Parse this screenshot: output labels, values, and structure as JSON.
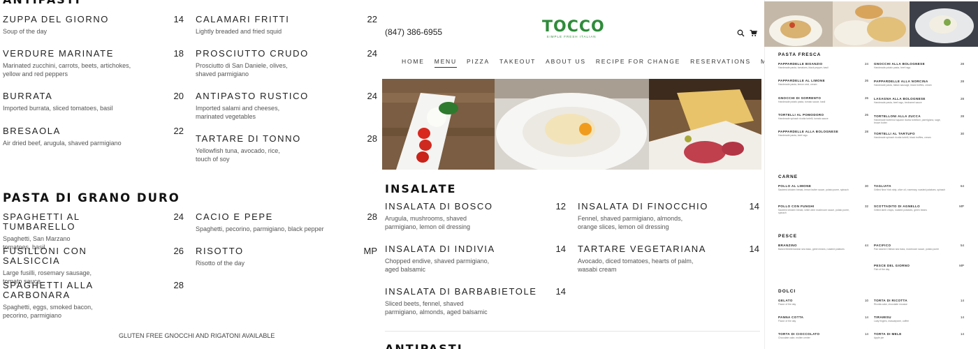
{
  "left": {
    "top_section_title": "ANTIPASTI",
    "antipasti_col1": [
      {
        "name": "ZUPPA DEL GIORNO",
        "desc": "Soup of the day",
        "price": "14"
      },
      {
        "name": "VERDURE MARINATE",
        "desc": "Marinated zucchini, carrots, beets, artichokes, yellow and red peppers",
        "price": "18"
      },
      {
        "name": "BURRATA",
        "desc": "Imported burrata, sliced tomatoes, basil",
        "price": "20"
      },
      {
        "name": "BRESAOLA",
        "desc": "Air dried beef, arugula, shaved parmigiano",
        "price": "22"
      }
    ],
    "antipasti_col2": [
      {
        "name": "CALAMARI FRITTI",
        "desc": "Lightly breaded and fried squid",
        "price": "22"
      },
      {
        "name": "PROSCIUTTO CRUDO",
        "desc": "Prosciutto di San Daniele, olives, shaved parmigiano",
        "price": "24"
      },
      {
        "name": "ANTIPASTO RUSTICO",
        "desc": "Imported salami and cheeses, marinated vegetables",
        "price": "24"
      },
      {
        "name": "TARTARE DI TONNO",
        "desc": "Yellowfish tuna, avocado, rice, touch of soy",
        "price": "28"
      }
    ],
    "pasta_title": "PASTA DI GRANO DURO",
    "pasta_col1": [
      {
        "name": "SPAGHETTI AL TUMBARELLO",
        "desc": "Spaghetti, San Marzano tomatoes, basil",
        "price": "24"
      },
      {
        "name": "FUSILLONI CON SALSICCIA",
        "desc": "Large fusilli, rosemary sausage, tomato sauce",
        "price": "26"
      },
      {
        "name": "SPAGHETTI ALLA CARBONARA",
        "desc": "Spaghetti, eggs, smoked bacon, pecorino, parmigiano",
        "price": "28"
      }
    ],
    "pasta_col2": [
      {
        "name": "CACIO E PEPE",
        "desc": "Spaghetti, pecorino, parmigiano, black pepper",
        "price": "28"
      },
      {
        "name": "RISOTTO",
        "desc": "Risotto of the day",
        "price": "MP"
      }
    ],
    "gluten_note": "GLUTEN FREE GNOCCHI AND RIGATONI AVAILABLE"
  },
  "center": {
    "phone": "(847) 386-6955",
    "logo": "TOCCO",
    "tagline": "SIMPLE FRESH ITALIAN",
    "brand_color": "#2e8b3a",
    "icons": [
      "search-icon",
      "cart-icon"
    ],
    "nav": [
      "HOME",
      "MENU",
      "PIZZA",
      "TAKEOUT",
      "ABOUT US",
      "RECIPE FOR CHANGE",
      "RESERVATIONS",
      "MORE ▾"
    ],
    "active_nav": "MENU",
    "insalate_title": "INSALATE",
    "insalate_col1": [
      {
        "name": "INSALATA DI BOSCO",
        "desc": "Arugula, mushrooms, shaved parmigiano, lemon oil dressing",
        "price": "12"
      },
      {
        "name": "INSALATA DI INDIVIA",
        "desc": "Chopped endive, shaved parmigiano, aged balsamic",
        "price": "14"
      },
      {
        "name": "INSALATA DI BARBABIETOLE",
        "desc": "Sliced beets, fennel, shaved parmigiano, almonds, aged balsamic",
        "price": "14"
      }
    ],
    "insalate_col2": [
      {
        "name": "INSALATA DI FINOCCHIO",
        "desc": "Fennel, shaved parmigiano, almonds, orange slices, lemon oil dressing",
        "price": "14"
      },
      {
        "name": "TARTARE VEGETARIANA",
        "desc": "Avocado, diced tomatoes, hearts of palm, wasabi cream",
        "price": "14"
      }
    ],
    "bottom_title": "ANTIPASTI"
  },
  "right": {
    "pasta_fresca": "PASTA FRESCA",
    "pf_col1": [
      {
        "name": "PAPPARDELLE BISANZIO",
        "desc": "Handmade pasta, tomatoes, black pepper, basil",
        "price": "24"
      },
      {
        "name": "PAPPARDELLE AL LIMONE",
        "desc": "Handmade pasta, lemon zest, cream",
        "price": "26"
      },
      {
        "name": "GNOCCHI DI SORRENTO",
        "desc": "Handmade potato pasta, tomato sauce, basil",
        "price": "26"
      },
      {
        "name": "TORTELLI AL POMODORO",
        "desc": "Handmade spinach ricotta tortelli, tomato sauce",
        "price": "26"
      },
      {
        "name": "PAPPARDELLE ALLA BOLOGNESE",
        "desc": "Handmade pasta, beef ragu",
        "price": "28"
      }
    ],
    "pf_col2": [
      {
        "name": "GNOCCHI ALLA BOLOGNESE",
        "desc": "Handmade potato pasta, beef ragu",
        "price": "28"
      },
      {
        "name": "PAPPARDELLE ALLA NORCINA",
        "desc": "Handmade pasta, Italian sausage, black truffles, cream",
        "price": "28"
      },
      {
        "name": "LASAGNA ALLA BOLOGNESE",
        "desc": "Handmade pasta, beef ragu, bechamel sauce",
        "price": "28"
      },
      {
        "name": "TORTELLONI ALLA ZUCCA",
        "desc": "Handmade butternut squash ricotta tortelloni, parmigiano, sage, brown butter",
        "price": "28"
      },
      {
        "name": "TORTELLI AL TARTUFO",
        "desc": "Handmade spinach ricotta tortelli, black truffles, cream",
        "price": "30"
      }
    ],
    "carne": "CARNE",
    "carne_col1": [
      {
        "name": "POLLO AL LIMONE",
        "desc": "Sauteed chicken breast, lemon butter sauce, potato puree, spinach",
        "price": "30"
      },
      {
        "name": "POLLO CON FUNGHI",
        "desc": "Sauteed chicken breast, white wine mushroom sauce, potato puree, spinach",
        "price": "32"
      }
    ],
    "carne_col2": [
      {
        "name": "TAGLIATA",
        "desc": "Grilled New York strip, olive oil, rosemary, roasted potatoes, spinach",
        "price": "64"
      },
      {
        "name": "SCOTTADITO DI AGNELLO",
        "desc": "Grilled lamb chops, roasted potatoes, green beans",
        "price": "MP"
      }
    ],
    "pesce": "PESCE",
    "pesce_col1": [
      {
        "name": "BRANZINO",
        "desc": "Baked Mediterranean sea bass, green beans, roasted potatoes",
        "price": "44"
      }
    ],
    "pesce_col2": [
      {
        "name": "PACIFICO",
        "desc": "Pan seared Chilean sea bass, mushroom sauce, potato puree",
        "price": "54"
      },
      {
        "name": "PESCE DEL GIORNO",
        "desc": "Fish of the day",
        "price": "MP"
      }
    ],
    "dolci": "DOLCI",
    "dolci_col1": [
      {
        "name": "GELATO",
        "desc": "Flavor of the day",
        "price": "10"
      },
      {
        "name": "PANNA COTTA",
        "desc": "Flavor of the day",
        "price": "14"
      },
      {
        "name": "TORTA DI CIOCCOLATO",
        "desc": "Chocolate cake, molten center",
        "price": "14"
      }
    ],
    "dolci_col2": [
      {
        "name": "TORTA DI RICOTTA",
        "desc": "Ricotta cake, chocolate mousse",
        "price": "14"
      },
      {
        "name": "TIRAMISU",
        "desc": "Lady fingers, mascarpone, coffee",
        "price": "14"
      },
      {
        "name": "TORTA DI MELE",
        "desc": "Apple pie",
        "price": "14"
      }
    ]
  }
}
